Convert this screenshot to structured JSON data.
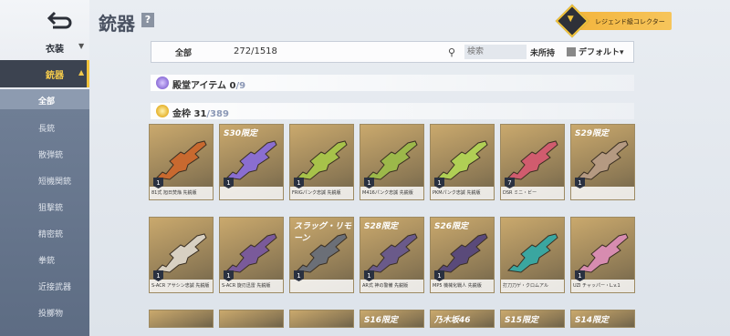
{
  "sidebar": {
    "costume_label": "衣装",
    "weapons_label": "銃器",
    "items": [
      {
        "label": "全部",
        "active": true
      },
      {
        "label": "長銃"
      },
      {
        "label": "散弾銃"
      },
      {
        "label": "短機関銃"
      },
      {
        "label": "狙撃銃"
      },
      {
        "label": "精密銃"
      },
      {
        "label": "拳銃"
      },
      {
        "label": "近接武器"
      },
      {
        "label": "投擲物"
      }
    ]
  },
  "header": {
    "title": "銃器",
    "help": "?",
    "collector_label": "レジェンド級コレクター"
  },
  "filter": {
    "all_label": "全部",
    "count": "272/1518",
    "search_placeholder": "検索",
    "unowned_label": "未所持",
    "sort_label": "デフォルト▾"
  },
  "sections": [
    {
      "label": "殿堂アイテム",
      "owned": "0",
      "total": "/9"
    },
    {
      "label": "金枠",
      "owned": "31",
      "total": "/389"
    }
  ],
  "cards_row1": [
    {
      "tag": "",
      "name": "81式 旭日焚焔 先鋭版",
      "level": "1"
    },
    {
      "tag": "S30限定",
      "name": "",
      "level": "1"
    },
    {
      "tag": "",
      "name": "FRIGパンク忠誠 先鋭版",
      "level": "1"
    },
    {
      "tag": "",
      "name": "M416パンク忠誠 先鋭版",
      "level": "1"
    },
    {
      "tag": "",
      "name": "PKMパンク忠誠 先鋭版",
      "level": "1"
    },
    {
      "tag": "",
      "name": "DSR ミニ・ビー",
      "level": "7"
    },
    {
      "tag": "S29限定",
      "name": "",
      "level": "1"
    }
  ],
  "cards_row2": [
    {
      "tag": "",
      "name": "S-ACR アサシン忠誠 先鋭版",
      "level": "1"
    },
    {
      "tag": "",
      "name": "S-ACR 旋刃迅雷 先鋭版",
      "level": "1"
    },
    {
      "tag": "スラッグ・リモーン",
      "name": "",
      "level": "1"
    },
    {
      "tag": "S28限定",
      "name": "AR式 神の警備 先鋭版",
      "level": "1"
    },
    {
      "tag": "S26限定",
      "name": "MP5 機械化戦人 先鋭版",
      "level": "1"
    },
    {
      "tag": "",
      "name": "打刀刀ゲ・クロムアル",
      "level": ""
    },
    {
      "tag": "",
      "name": "UZI チャッパー・L.v.1",
      "level": "1"
    }
  ],
  "cards_row3": [
    {
      "tag": ""
    },
    {
      "tag": ""
    },
    {
      "tag": ""
    },
    {
      "tag": "S16限定"
    },
    {
      "tag": "乃木坂46"
    },
    {
      "tag": "S15限定"
    },
    {
      "tag": "S14限定"
    }
  ],
  "colors": {
    "accent": "#f0c23a",
    "sidebar_active": "#3c4350"
  }
}
